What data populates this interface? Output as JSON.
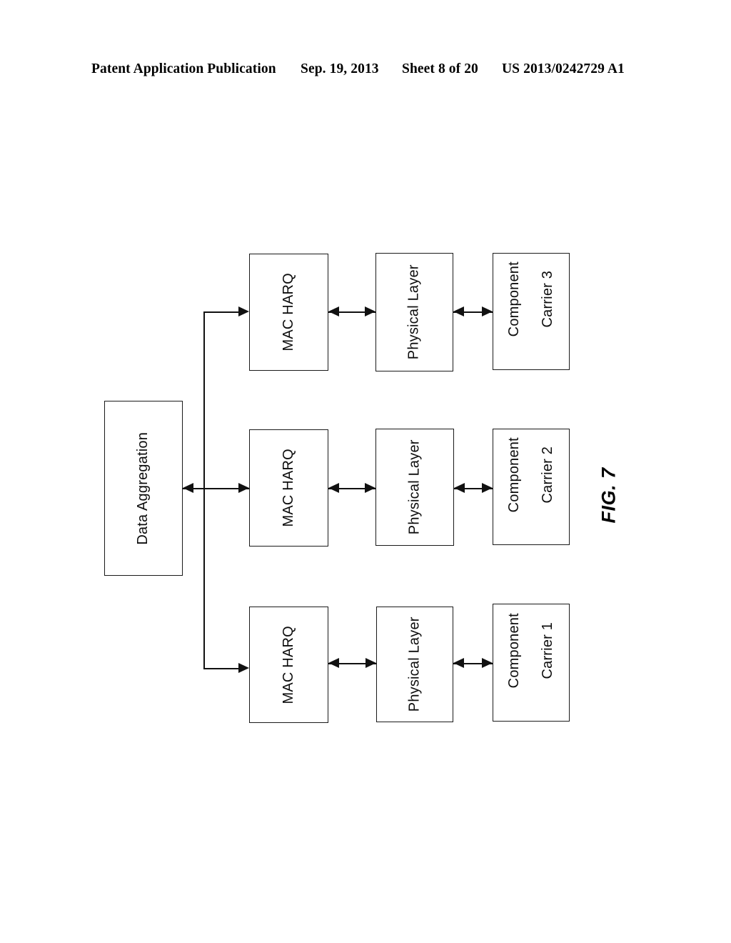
{
  "header": {
    "publication": "Patent Application Publication",
    "date": "Sep. 19, 2013",
    "sheet": "Sheet 8 of 20",
    "patent_number": "US 2013/0242729 A1"
  },
  "figure": {
    "caption": "FIG. 7",
    "orientation": "landscape-rotated-90-ccw"
  },
  "diagram": {
    "type": "block-diagram",
    "aggregator": {
      "label": "Data Aggregation"
    },
    "chains": [
      {
        "row": "top",
        "mac": "MAC HARQ",
        "phy": "Physical Layer",
        "carrier_line1": "Component",
        "carrier_line2": "Carrier 3",
        "carrier_full": "Component Carrier 3"
      },
      {
        "row": "middle",
        "mac": "MAC HARQ",
        "phy": "Physical Layer",
        "carrier_line1": "Component",
        "carrier_line2": "Carrier 2",
        "carrier_full": "Component Carrier 2"
      },
      {
        "row": "bottom",
        "mac": "MAC HARQ",
        "phy": "Physical Layer",
        "carrier_line1": "Component",
        "carrier_line2": "Carrier 1",
        "carrier_full": "Component Carrier 1"
      }
    ],
    "connections": [
      {
        "from": "Data Aggregation",
        "to": "MAC HARQ (top)",
        "style": "single-arrow-right-via-bus"
      },
      {
        "from": "Data Aggregation",
        "to": "MAC HARQ (middle)",
        "style": "double-arrow"
      },
      {
        "from": "Data Aggregation",
        "to": "MAC HARQ (bottom)",
        "style": "single-arrow-right-via-bus"
      },
      {
        "from": "MAC HARQ (top)",
        "to": "Physical Layer (top)",
        "style": "double-arrow"
      },
      {
        "from": "Physical Layer (top)",
        "to": "Component Carrier 3",
        "style": "double-arrow"
      },
      {
        "from": "MAC HARQ (middle)",
        "to": "Physical Layer (middle)",
        "style": "double-arrow"
      },
      {
        "from": "Physical Layer (middle)",
        "to": "Component Carrier 2",
        "style": "double-arrow"
      },
      {
        "from": "MAC HARQ (bottom)",
        "to": "Physical Layer (bottom)",
        "style": "double-arrow"
      },
      {
        "from": "Physical Layer (bottom)",
        "to": "Component Carrier 1",
        "style": "double-arrow"
      }
    ]
  },
  "colors": {
    "ink": "#111111",
    "paper": "#ffffff"
  }
}
